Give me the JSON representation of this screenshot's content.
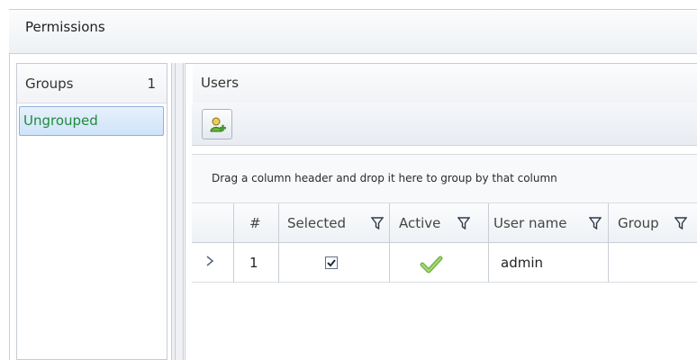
{
  "header": {
    "title": "Permissions"
  },
  "groups": {
    "title": "Groups",
    "count": "1",
    "items": [
      {
        "label": "Ungrouped"
      }
    ]
  },
  "users": {
    "title": "Users",
    "group_drop_text": "Drag a column header and drop it here to group by that column",
    "columns": [
      {
        "label": "#"
      },
      {
        "label": "Selected"
      },
      {
        "label": "Active"
      },
      {
        "label": "User name"
      },
      {
        "label": "Group"
      }
    ],
    "rows": [
      {
        "number": "1",
        "selected": true,
        "active": true,
        "user_name": "admin",
        "group": ""
      }
    ]
  },
  "icons": {
    "add_user": "add-user-icon",
    "filter": "filter-icon",
    "row_indicator": "chevron-right-icon",
    "active": "checkmark-icon",
    "checkbox": "checkbox-checked-icon"
  },
  "colors": {
    "group_selected_text": "#208a3c",
    "selection_bg": "#cfe3f8",
    "selection_border": "#8fb3dc",
    "checkmark": "#7ab648"
  }
}
